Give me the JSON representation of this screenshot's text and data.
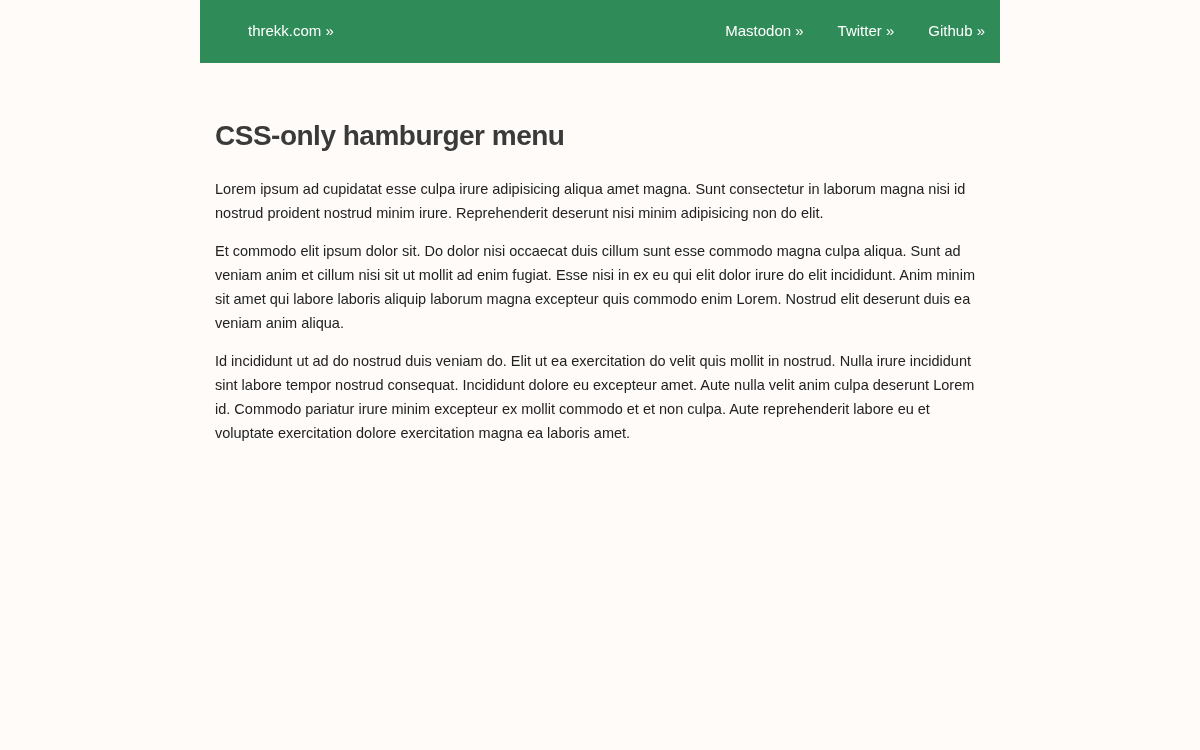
{
  "header": {
    "brand": "threkk.com »",
    "links": [
      {
        "label": "Mastodon »"
      },
      {
        "label": "Twitter »"
      },
      {
        "label": "Github »"
      }
    ]
  },
  "article": {
    "title": "CSS-only hamburger menu",
    "paragraphs": [
      "Lorem ipsum ad cupidatat esse culpa irure adipisicing aliqua amet magna. Sunt consectetur in laborum magna nisi id nostrud proident nostrud minim irure. Reprehenderit deserunt nisi minim adipisicing non do elit.",
      "Et commodo elit ipsum dolor sit. Do dolor nisi occaecat duis cillum sunt esse commodo magna culpa aliqua. Sunt ad veniam anim et cillum nisi sit ut mollit ad enim fugiat. Esse nisi in ex eu qui elit dolor irure do elit incididunt. Anim minim sit amet qui labore laboris aliquip laborum magna excepteur quis commodo enim Lorem. Nostrud elit deserunt duis ea veniam anim aliqua.",
      "Id incididunt ut ad do nostrud duis veniam do. Elit ut ea exercitation do velit quis mollit in nostrud. Nulla irure incididunt sint labore tempor nostrud consequat. Incididunt dolore eu excepteur amet. Aute nulla velit anim culpa deserunt Lorem id. Commodo pariatur irure minim excepteur ex mollit commodo et et non culpa. Aute reprehenderit labore eu et voluptate exercitation dolore exercitation magna ea laboris amet."
    ]
  }
}
